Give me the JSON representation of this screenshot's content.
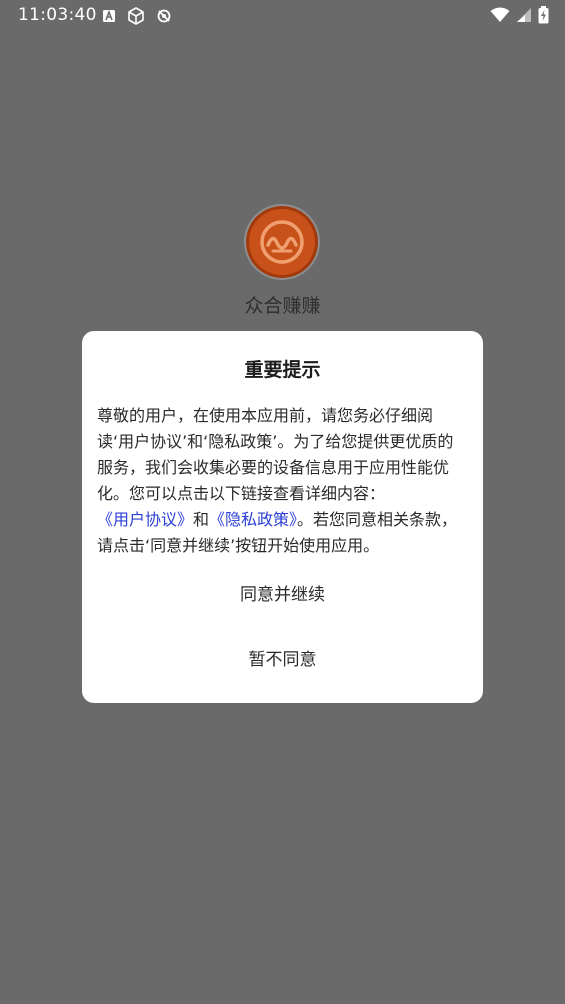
{
  "status_bar": {
    "time": "11:03:40",
    "left_icons": [
      "text-a-icon",
      "cube-icon",
      "sync-icon"
    ],
    "right_icons": [
      "wifi-icon",
      "signal-icon",
      "battery-charging-icon"
    ]
  },
  "app": {
    "name": "众合赚赚",
    "logo_colors": {
      "outer": "#8a8a8a",
      "ring": "#c24a10",
      "inner": "#d96a1e"
    }
  },
  "dialog": {
    "title": "重要提示",
    "body": {
      "part1": "尊敬的用户，在使用本应用前，请您务必仔细阅读‘用户协议’和‘隐私政策’。为了给您提供更优质的服务，我们会收集必要的设备信息用于应用性能优化。您可以点击以下链接查看详细内容：",
      "link_user_agreement": "《用户协议》",
      "and": "和",
      "link_privacy_policy": "《隐私政策》",
      "part2": "。若您同意相关条款，请点击‘同意并继续’按钮开始使用应用。"
    },
    "agree_button": "同意并继续",
    "disagree_button": "暂不同意"
  },
  "colors": {
    "overlay": "#6a6a6a",
    "dialog_bg": "#ffffff",
    "link": "#2b3fd6"
  }
}
